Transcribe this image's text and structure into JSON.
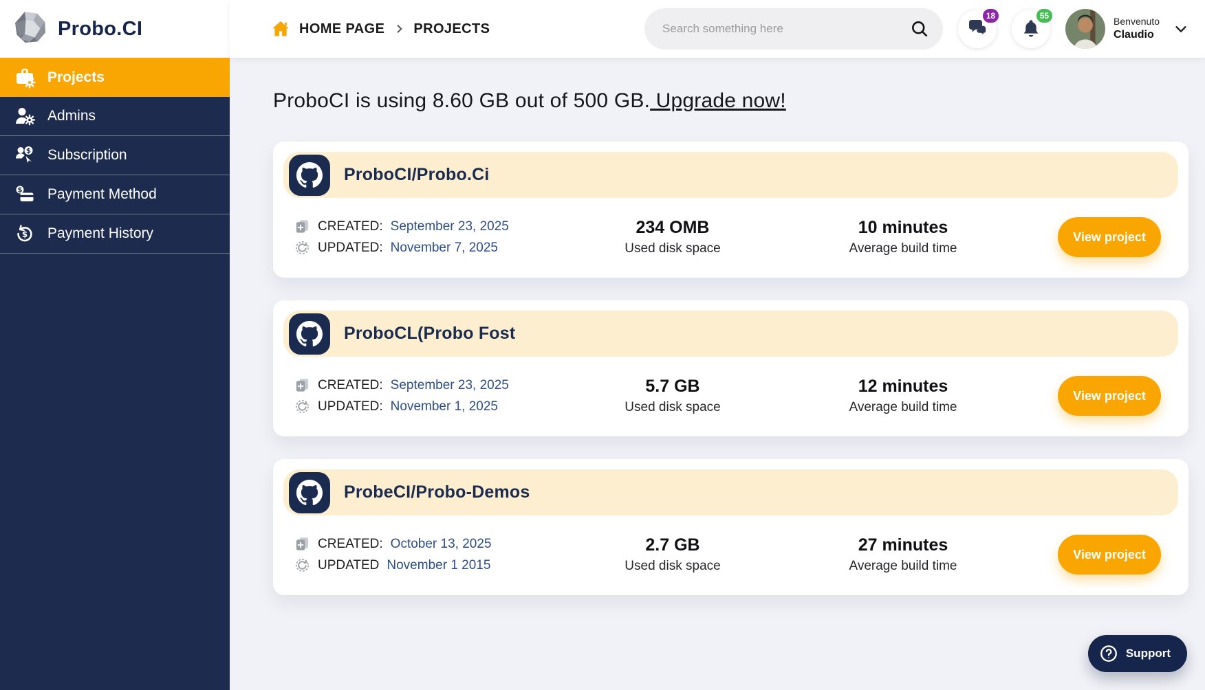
{
  "app": {
    "name": "Probo.CI"
  },
  "sidebar": {
    "items": [
      {
        "label": "Projects",
        "active": true
      },
      {
        "label": "Admins"
      },
      {
        "label": "Subscription"
      },
      {
        "label": "Payment Method"
      },
      {
        "label": "Payment History"
      }
    ]
  },
  "header": {
    "breadcrumb": {
      "home": "HOME PAGE",
      "current": "PROJECTS"
    },
    "search": {
      "placeholder": "Search something here"
    },
    "messages_badge": "18",
    "notifications_badge": "55",
    "user": {
      "greeting": "Benvenuto",
      "name": "Claudio"
    }
  },
  "main": {
    "usage_heading": {
      "text": "ProboCI is using 8.60 GB out of 500 GB.",
      "link": " Upgrade now!"
    },
    "projects": [
      {
        "title": "ProboCI/Probo.Ci",
        "created_label": "CREATED:",
        "created_date": "September 23, 2025",
        "updated_label": "UPDATED:",
        "updated_date": "November 7, 2025",
        "disk_value": "234 OMB",
        "disk_label": "Used disk space",
        "build_value": "10 minutes",
        "build_label": "Average build time",
        "button_label": "View project"
      },
      {
        "title": "ProboCL(Probo Fost",
        "created_label": "CREATED:",
        "created_date": "September 23, 2025",
        "updated_label": "UPDATED:",
        "updated_date": "November 1, 2025",
        "disk_value": "5.7 GB",
        "disk_label": "Used disk space",
        "build_value": "12 minutes",
        "build_label": "Average build time",
        "button_label": "View project"
      },
      {
        "title": "ProbeCI/Probo-Demos",
        "created_label": "CREATED:",
        "created_date": "October 13, 2025",
        "updated_label": "UPDATED",
        "updated_date": "November 1 2015",
        "disk_value": "2.7 GB",
        "disk_label": "Used disk space",
        "build_value": "27 minutes",
        "build_label": "Average build time",
        "button_label": "View project"
      }
    ]
  },
  "support": {
    "label": "Support"
  },
  "colors": {
    "accent_orange": "#F9A602",
    "sidebar_navy": "#1C2B4E",
    "banner_cream": "#FCEECF",
    "badge_purple": "#8E24AA",
    "badge_green": "#43BD52",
    "date_blue": "#2C4D86",
    "support_navy": "#16254C"
  }
}
